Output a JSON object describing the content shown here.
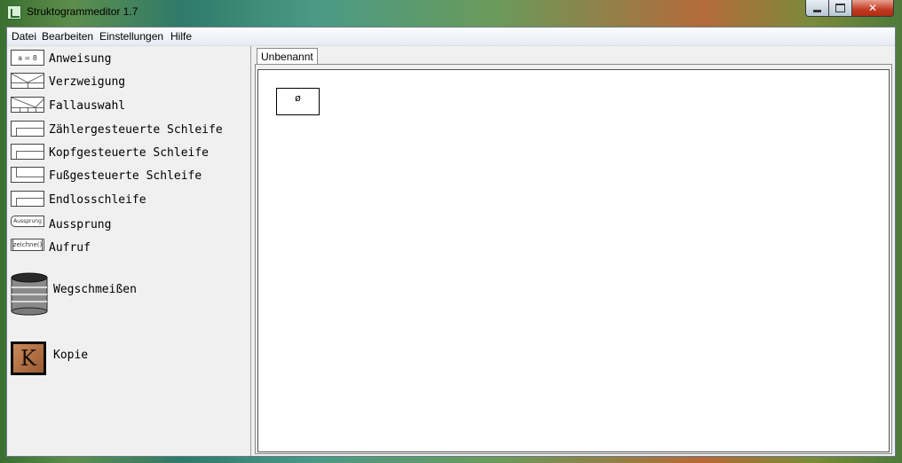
{
  "window": {
    "title": "Struktogrammeditor 1.7"
  },
  "menu": {
    "datei": "Datei",
    "bearbeiten": "Bearbeiten",
    "einstellungen": "Einstellungen",
    "hilfe": "Hilfe"
  },
  "palette": {
    "items": [
      {
        "label": "Anweisung",
        "icon_text": "a = 8",
        "icon": "statement-icon"
      },
      {
        "label": "Verzweigung",
        "icon_text": "",
        "icon": "branch-icon"
      },
      {
        "label": "Fallauswahl",
        "icon_text": "",
        "icon": "case-icon"
      },
      {
        "label": "Zählergesteuerte Schleife",
        "icon_text": "",
        "icon": "counter-loop-icon"
      },
      {
        "label": "Kopfgesteuerte Schleife",
        "icon_text": "",
        "icon": "head-loop-icon"
      },
      {
        "label": "Fußgesteuerte Schleife",
        "icon_text": "",
        "icon": "foot-loop-icon"
      },
      {
        "label": "Endlosschleife",
        "icon_text": "",
        "icon": "endless-loop-icon"
      },
      {
        "label": "Aussprung",
        "icon_text": "Aussprung",
        "icon": "exit-icon"
      },
      {
        "label": "Aufruf",
        "icon_text": "zeichne()",
        "icon": "call-icon"
      }
    ],
    "trash_label": "Wegschmeißen",
    "copy_label": "Kopie",
    "copy_letter": "K"
  },
  "tabs": [
    {
      "label": "Unbenannt"
    }
  ],
  "canvas": {
    "empty_block_text": "ø"
  }
}
